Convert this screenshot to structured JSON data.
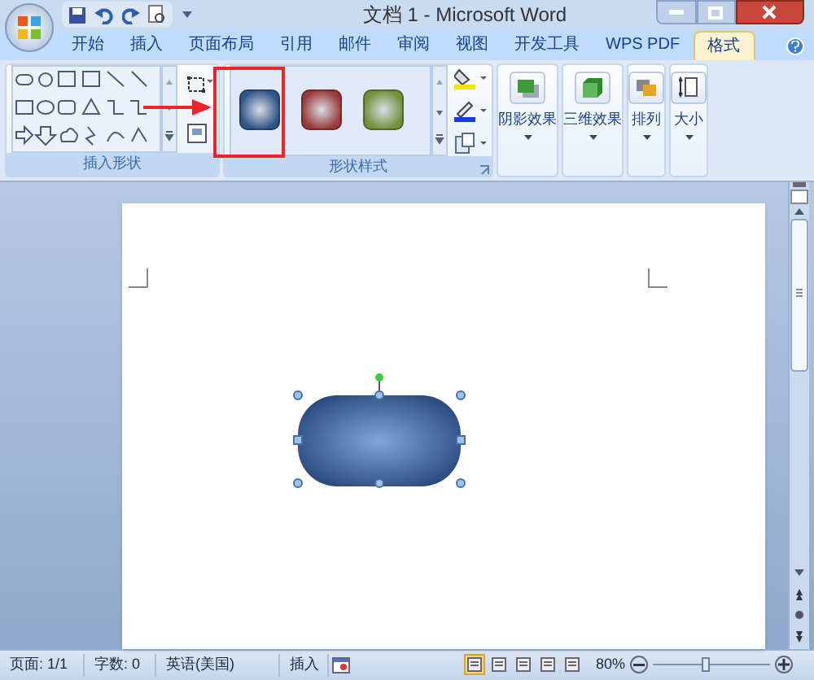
{
  "window": {
    "title": "文档 1 - Microsoft Word"
  },
  "tabs": [
    {
      "label": "开始",
      "selected": false
    },
    {
      "label": "插入",
      "selected": false
    },
    {
      "label": "页面布局",
      "selected": false
    },
    {
      "label": "引用",
      "selected": false
    },
    {
      "label": "邮件",
      "selected": false
    },
    {
      "label": "审阅",
      "selected": false
    },
    {
      "label": "视图",
      "selected": false
    },
    {
      "label": "开发工具",
      "selected": false
    },
    {
      "label": "WPS PDF",
      "selected": false
    },
    {
      "label": "格式",
      "selected": true
    }
  ],
  "ribbon": {
    "insert_shapes": {
      "label": "插入形状"
    },
    "shape_styles": {
      "label": "形状样式",
      "styles": [
        {
          "color": "#2f5688"
        },
        {
          "color": "#9a3a3a"
        },
        {
          "color": "#73913b"
        }
      ]
    },
    "buttons": [
      {
        "label": "阴影效果"
      },
      {
        "label": "三维效果"
      },
      {
        "label": "排列"
      },
      {
        "label": "大小"
      }
    ]
  },
  "status_bar": {
    "items": [
      "页面: 1/1",
      "字数: 0",
      "英语(美国)",
      "插入"
    ],
    "zoom": "80%",
    "zoom_slider": {
      "level": 0.45
    }
  }
}
